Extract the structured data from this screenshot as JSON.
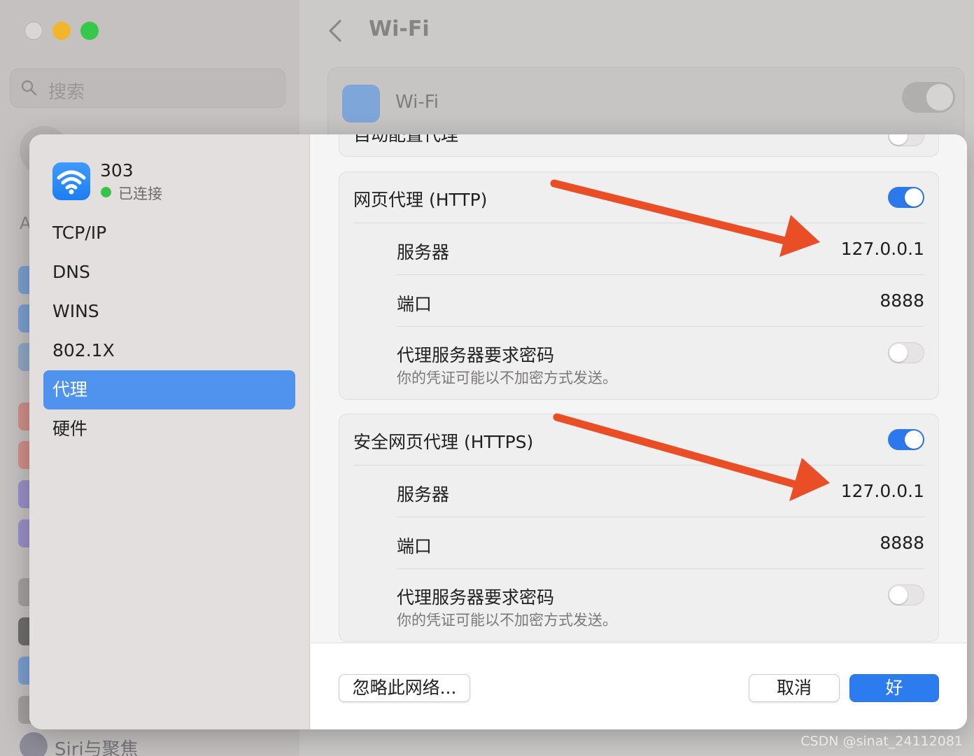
{
  "background": {
    "search_placeholder": "搜索",
    "sidebar_letter": "A",
    "siri_label": "Siri与聚焦",
    "page_title": "Wi-Fi",
    "wifi_label": "Wi-Fi"
  },
  "sheet": {
    "network": {
      "name": "303",
      "status": "已连接"
    },
    "nav": [
      "TCP/IP",
      "DNS",
      "WINS",
      "802.1X",
      "代理",
      "硬件"
    ],
    "active_nav": "代理",
    "top_partial_label": "自动配置代理",
    "http": {
      "title": "网页代理 (HTTP)",
      "enabled": true,
      "server_label": "服务器",
      "server_value": "127.0.0.1",
      "port_label": "端口",
      "port_value": "8888",
      "auth_label": "代理服务器要求密码",
      "auth_note": "你的凭证可能以不加密方式发送。",
      "auth_enabled": false
    },
    "https": {
      "title": "安全网页代理 (HTTPS)",
      "enabled": true,
      "server_label": "服务器",
      "server_value": "127.0.0.1",
      "port_label": "端口",
      "port_value": "8888",
      "auth_label": "代理服务器要求密码",
      "auth_note": "你的凭证可能以不加密方式发送。",
      "auth_enabled": false
    },
    "buttons": {
      "ignore": "忽略此网络...",
      "cancel": "取消",
      "ok": "好"
    }
  },
  "colors": {
    "accent": "#2c79ee",
    "annotation_arrow": "#e94e27",
    "connected_dot": "#37c24a"
  },
  "watermark": "CSDN @sinat_24112081"
}
